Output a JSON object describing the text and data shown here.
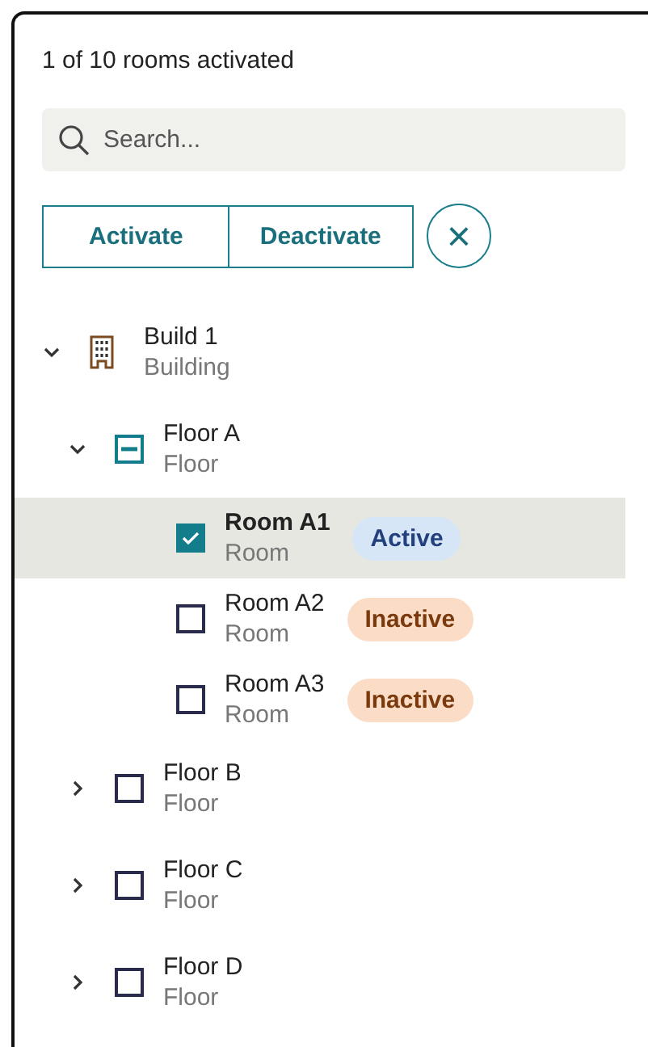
{
  "summary": "1 of 10 rooms activated",
  "search": {
    "placeholder": "Search..."
  },
  "actions": [
    {
      "label": "Activate"
    },
    {
      "label": "Deactivate"
    }
  ],
  "clear_button": {
    "label": "×"
  },
  "tree": [
    {
      "kind": "building",
      "name": "Build 1",
      "type": "Building",
      "expanded": true,
      "children": [
        {
          "kind": "floor",
          "name": "Floor A",
          "type": "Floor",
          "expanded": true,
          "checked": false,
          "indeterminate": true,
          "children": [
            {
              "kind": "room",
              "name": "Room A1",
              "type": "Room",
              "selected": true,
              "checked": true,
              "status": {
                "label": "Active",
                "kind": "active"
              }
            },
            {
              "kind": "room",
              "name": "Room A2",
              "type": "Room",
              "selected": false,
              "checked": false,
              "status": {
                "label": "Inactive",
                "kind": "inactive"
              }
            },
            {
              "kind": "room",
              "name": "Room A3",
              "type": "Room",
              "selected": false,
              "checked": false,
              "status": {
                "label": "Inactive",
                "kind": "inactive"
              }
            }
          ]
        },
        {
          "kind": "floor",
          "name": "Floor B",
          "type": "Floor",
          "expanded": false,
          "checked": false
        },
        {
          "kind": "floor",
          "name": "Floor C",
          "type": "Floor",
          "expanded": false,
          "checked": false
        },
        {
          "kind": "floor",
          "name": "Floor D",
          "type": "Floor",
          "expanded": false,
          "checked": false
        }
      ]
    }
  ]
}
